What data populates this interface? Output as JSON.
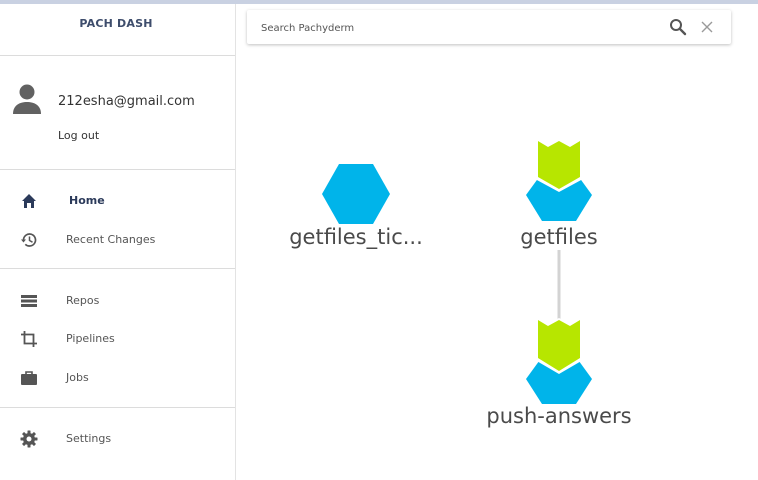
{
  "app": {
    "brand": "PACH DASH"
  },
  "user": {
    "email": "212esha@gmail.com",
    "logout_label": "Log out"
  },
  "nav": {
    "primary": [
      {
        "label": "Home",
        "icon": "home-icon",
        "active": true
      },
      {
        "label": "Recent Changes",
        "icon": "history-icon"
      }
    ],
    "secondary": [
      {
        "label": "Repos",
        "icon": "list-icon"
      },
      {
        "label": "Pipelines",
        "icon": "crop-icon"
      },
      {
        "label": "Jobs",
        "icon": "briefcase-icon"
      }
    ],
    "tertiary": [
      {
        "label": "Settings",
        "icon": "gear-icon"
      }
    ]
  },
  "search": {
    "placeholder": "Search Pachyderm",
    "value": ""
  },
  "graph": {
    "nodes": [
      {
        "label": "getfiles_tic...",
        "type": "repo"
      },
      {
        "label": "getfiles",
        "type": "pipeline"
      },
      {
        "label": "push-answers",
        "type": "pipeline"
      }
    ]
  },
  "colors": {
    "repo": "#00b4ea",
    "pipeline_marker": "#b7e600",
    "edge": "#d3d3d3",
    "nav_active": "#2b3a5a",
    "icon": "#555555"
  }
}
